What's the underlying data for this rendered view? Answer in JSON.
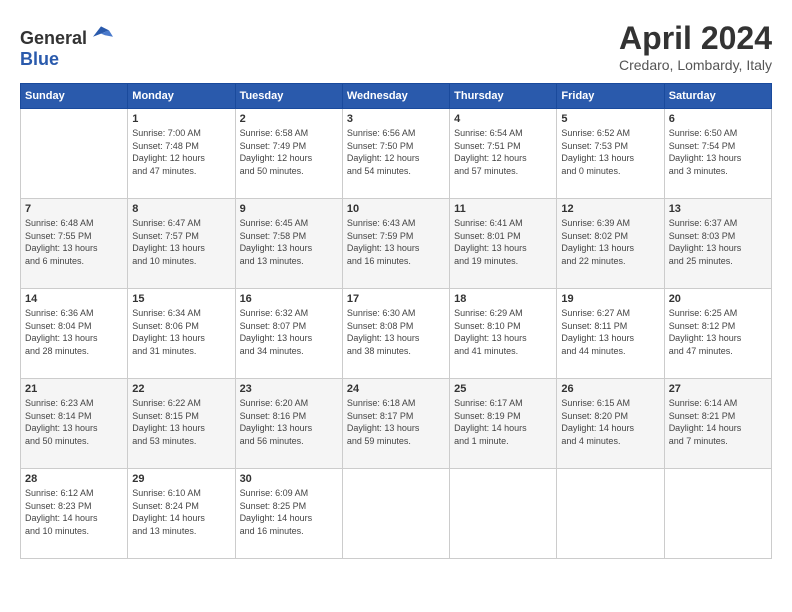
{
  "header": {
    "logo_general": "General",
    "logo_blue": "Blue",
    "month_title": "April 2024",
    "location": "Credaro, Lombardy, Italy"
  },
  "weekdays": [
    "Sunday",
    "Monday",
    "Tuesday",
    "Wednesday",
    "Thursday",
    "Friday",
    "Saturday"
  ],
  "weeks": [
    [
      {
        "day": "",
        "info": ""
      },
      {
        "day": "1",
        "info": "Sunrise: 7:00 AM\nSunset: 7:48 PM\nDaylight: 12 hours\nand 47 minutes."
      },
      {
        "day": "2",
        "info": "Sunrise: 6:58 AM\nSunset: 7:49 PM\nDaylight: 12 hours\nand 50 minutes."
      },
      {
        "day": "3",
        "info": "Sunrise: 6:56 AM\nSunset: 7:50 PM\nDaylight: 12 hours\nand 54 minutes."
      },
      {
        "day": "4",
        "info": "Sunrise: 6:54 AM\nSunset: 7:51 PM\nDaylight: 12 hours\nand 57 minutes."
      },
      {
        "day": "5",
        "info": "Sunrise: 6:52 AM\nSunset: 7:53 PM\nDaylight: 13 hours\nand 0 minutes."
      },
      {
        "day": "6",
        "info": "Sunrise: 6:50 AM\nSunset: 7:54 PM\nDaylight: 13 hours\nand 3 minutes."
      }
    ],
    [
      {
        "day": "7",
        "info": "Sunrise: 6:48 AM\nSunset: 7:55 PM\nDaylight: 13 hours\nand 6 minutes."
      },
      {
        "day": "8",
        "info": "Sunrise: 6:47 AM\nSunset: 7:57 PM\nDaylight: 13 hours\nand 10 minutes."
      },
      {
        "day": "9",
        "info": "Sunrise: 6:45 AM\nSunset: 7:58 PM\nDaylight: 13 hours\nand 13 minutes."
      },
      {
        "day": "10",
        "info": "Sunrise: 6:43 AM\nSunset: 7:59 PM\nDaylight: 13 hours\nand 16 minutes."
      },
      {
        "day": "11",
        "info": "Sunrise: 6:41 AM\nSunset: 8:01 PM\nDaylight: 13 hours\nand 19 minutes."
      },
      {
        "day": "12",
        "info": "Sunrise: 6:39 AM\nSunset: 8:02 PM\nDaylight: 13 hours\nand 22 minutes."
      },
      {
        "day": "13",
        "info": "Sunrise: 6:37 AM\nSunset: 8:03 PM\nDaylight: 13 hours\nand 25 minutes."
      }
    ],
    [
      {
        "day": "14",
        "info": "Sunrise: 6:36 AM\nSunset: 8:04 PM\nDaylight: 13 hours\nand 28 minutes."
      },
      {
        "day": "15",
        "info": "Sunrise: 6:34 AM\nSunset: 8:06 PM\nDaylight: 13 hours\nand 31 minutes."
      },
      {
        "day": "16",
        "info": "Sunrise: 6:32 AM\nSunset: 8:07 PM\nDaylight: 13 hours\nand 34 minutes."
      },
      {
        "day": "17",
        "info": "Sunrise: 6:30 AM\nSunset: 8:08 PM\nDaylight: 13 hours\nand 38 minutes."
      },
      {
        "day": "18",
        "info": "Sunrise: 6:29 AM\nSunset: 8:10 PM\nDaylight: 13 hours\nand 41 minutes."
      },
      {
        "day": "19",
        "info": "Sunrise: 6:27 AM\nSunset: 8:11 PM\nDaylight: 13 hours\nand 44 minutes."
      },
      {
        "day": "20",
        "info": "Sunrise: 6:25 AM\nSunset: 8:12 PM\nDaylight: 13 hours\nand 47 minutes."
      }
    ],
    [
      {
        "day": "21",
        "info": "Sunrise: 6:23 AM\nSunset: 8:14 PM\nDaylight: 13 hours\nand 50 minutes."
      },
      {
        "day": "22",
        "info": "Sunrise: 6:22 AM\nSunset: 8:15 PM\nDaylight: 13 hours\nand 53 minutes."
      },
      {
        "day": "23",
        "info": "Sunrise: 6:20 AM\nSunset: 8:16 PM\nDaylight: 13 hours\nand 56 minutes."
      },
      {
        "day": "24",
        "info": "Sunrise: 6:18 AM\nSunset: 8:17 PM\nDaylight: 13 hours\nand 59 minutes."
      },
      {
        "day": "25",
        "info": "Sunrise: 6:17 AM\nSunset: 8:19 PM\nDaylight: 14 hours\nand 1 minute."
      },
      {
        "day": "26",
        "info": "Sunrise: 6:15 AM\nSunset: 8:20 PM\nDaylight: 14 hours\nand 4 minutes."
      },
      {
        "day": "27",
        "info": "Sunrise: 6:14 AM\nSunset: 8:21 PM\nDaylight: 14 hours\nand 7 minutes."
      }
    ],
    [
      {
        "day": "28",
        "info": "Sunrise: 6:12 AM\nSunset: 8:23 PM\nDaylight: 14 hours\nand 10 minutes."
      },
      {
        "day": "29",
        "info": "Sunrise: 6:10 AM\nSunset: 8:24 PM\nDaylight: 14 hours\nand 13 minutes."
      },
      {
        "day": "30",
        "info": "Sunrise: 6:09 AM\nSunset: 8:25 PM\nDaylight: 14 hours\nand 16 minutes."
      },
      {
        "day": "",
        "info": ""
      },
      {
        "day": "",
        "info": ""
      },
      {
        "day": "",
        "info": ""
      },
      {
        "day": "",
        "info": ""
      }
    ]
  ]
}
